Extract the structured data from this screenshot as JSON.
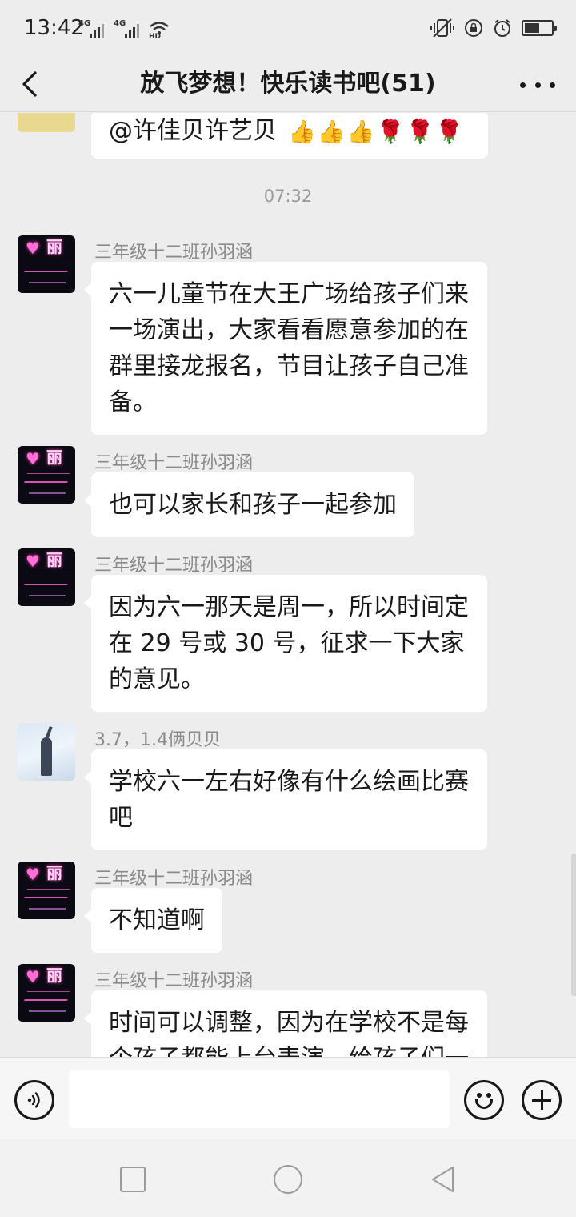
{
  "status_bar": {
    "time": "13:42",
    "signal1_label": "4G",
    "signal2_label": "4G",
    "hd_label": "HD",
    "battery_level": 0.55
  },
  "nav": {
    "title": "放飞梦想！快乐读书吧(51)",
    "back_icon": "chevron-left-icon",
    "more_icon": "more-dots-icon"
  },
  "chat": {
    "partial_message": {
      "text": "@许佳贝许艺贝",
      "emojis": [
        "👍",
        "👍",
        "👍",
        "🌹",
        "🌹",
        "🌹"
      ]
    },
    "time_divider": "07:32",
    "messages": [
      {
        "sender": "三年级十二班孙羽涵",
        "text": "六一儿童节在大王广场给孩子们来一场演出，大家看看愿意参加的在群里接龙报名，节目让孩子自己准备。"
      },
      {
        "sender": "三年级十二班孙羽涵",
        "text": "也可以家长和孩子一起参加"
      },
      {
        "sender": "三年级十二班孙羽涵",
        "text": "因为六一那天是周一，所以时间定在 29 号或 30 号，征求一下大家的意见。"
      },
      {
        "sender": "3.7，1.4俩贝贝",
        "text": "学校六一左右好像有什么绘画比赛吧"
      },
      {
        "sender": "三年级十二班孙羽涵",
        "text": "不知道啊"
      },
      {
        "sender": "三年级十二班孙羽涵",
        "text": "时间可以调整，因为在学校不是每个孩子都能上台表演，给孩子们一"
      }
    ]
  },
  "input_bar": {
    "voice_icon": "voice-icon",
    "emoji_icon": "emoji-icon",
    "plus_icon": "plus-icon",
    "value": ""
  },
  "system_nav": {
    "recent_icon": "square-icon",
    "home_icon": "circle-icon",
    "back_icon": "triangle-back-icon"
  }
}
